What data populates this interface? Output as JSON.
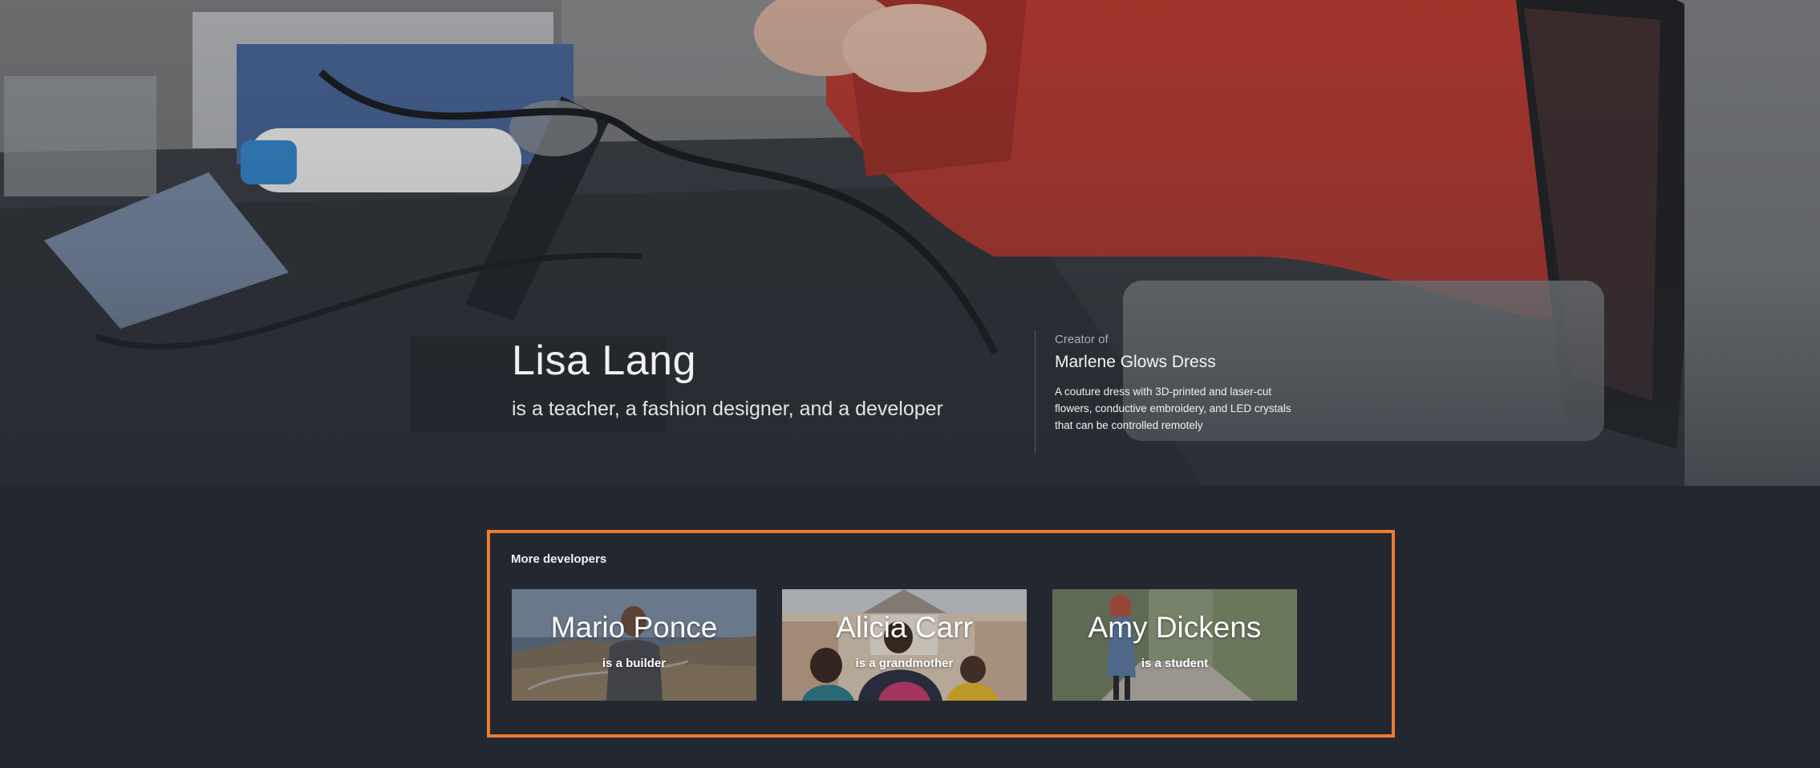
{
  "hero": {
    "name": "Lisa Lang",
    "tagline": "is a teacher, a fashion designer, and a developer",
    "creator_label": "Creator of",
    "project_title": "Marlene Glows Dress",
    "project_description": "A couture dress with 3D-printed and laser-cut flowers, conductive embroidery, and LED crystals that can be controlled remotely"
  },
  "more_developers": {
    "heading": "More developers",
    "developers": [
      {
        "name": "Mario Ponce",
        "role": "is a builder"
      },
      {
        "name": "Alicia Carr",
        "role": "is a grandmother"
      },
      {
        "name": "Amy Dickens",
        "role": "is a student"
      }
    ]
  },
  "colors": {
    "page_background": "#232830",
    "highlight_border": "#ec7c2c",
    "shirt_red": "#a2342c"
  }
}
